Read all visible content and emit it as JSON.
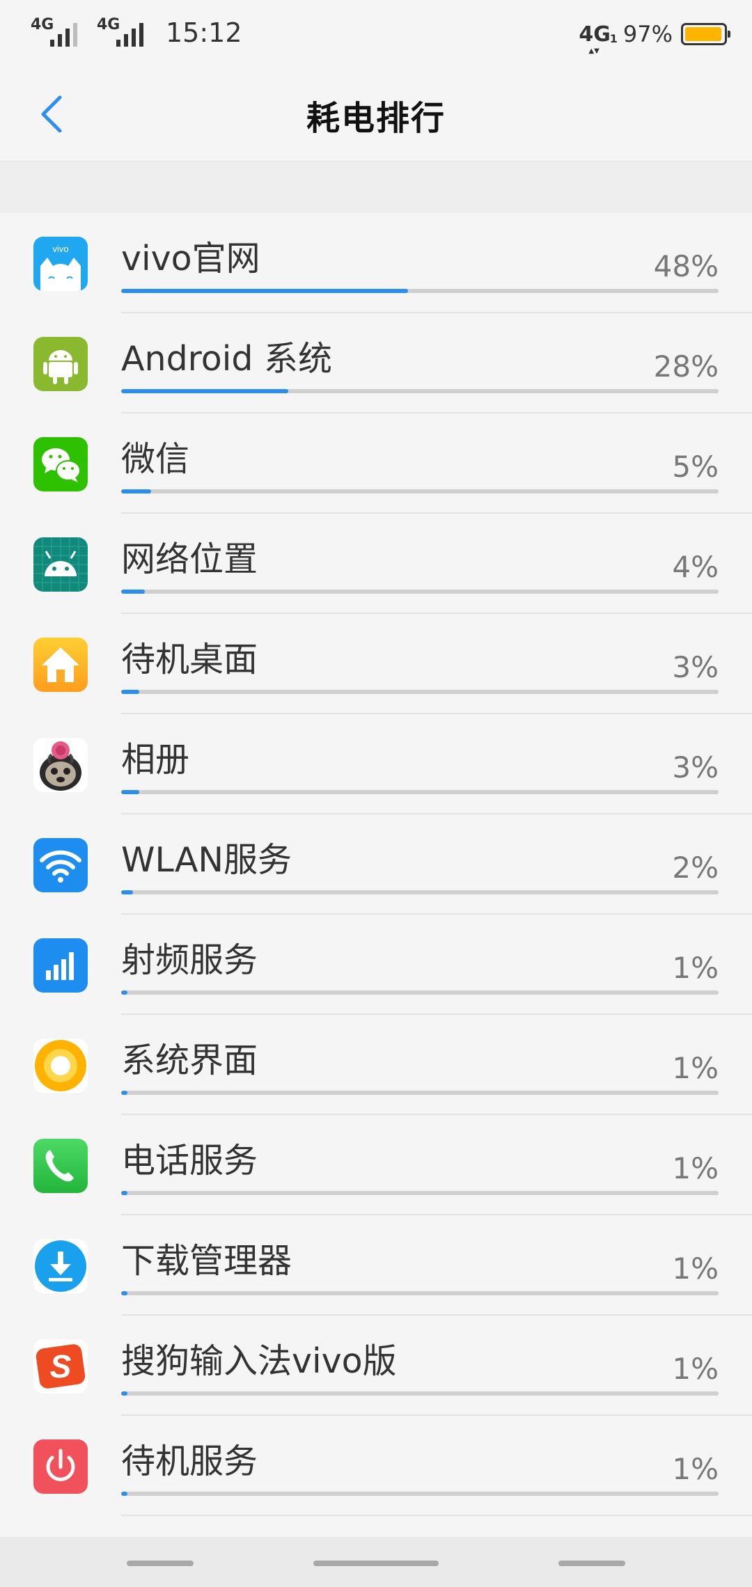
{
  "status_bar": {
    "sim1_type": "4G",
    "sim2_type": "4G",
    "time": "15:12",
    "data_network": "4G",
    "data_sim_index": "1",
    "battery_percent": "97%",
    "battery_level": 0.97,
    "battery_color": "#ffb400"
  },
  "header": {
    "title": "耗电排行",
    "back_icon": "chevron-left-icon",
    "accent": "#2b8ff0"
  },
  "apps": [
    {
      "name": "vivo官网",
      "percent": "48%",
      "value": 48,
      "icon": "vivo-mascot-icon"
    },
    {
      "name": "Android 系统",
      "percent": "28%",
      "value": 28,
      "icon": "android-robot-icon"
    },
    {
      "name": "微信",
      "percent": "5%",
      "value": 5,
      "icon": "wechat-icon"
    },
    {
      "name": "网络位置",
      "percent": "4%",
      "value": 4,
      "icon": "android-head-grid-icon"
    },
    {
      "name": "待机桌面",
      "percent": "3%",
      "value": 3,
      "icon": "home-icon"
    },
    {
      "name": "相册",
      "percent": "3%",
      "value": 3,
      "icon": "photo-avatar-icon"
    },
    {
      "name": "WLAN服务",
      "percent": "2%",
      "value": 2,
      "icon": "wifi-icon"
    },
    {
      "name": "射频服务",
      "percent": "1%",
      "value": 1,
      "icon": "signal-bars-icon"
    },
    {
      "name": "系统界面",
      "percent": "1%",
      "value": 1,
      "icon": "ring-icon"
    },
    {
      "name": "电话服务",
      "percent": "1%",
      "value": 1,
      "icon": "phone-icon"
    },
    {
      "name": "下载管理器",
      "percent": "1%",
      "value": 1,
      "icon": "download-icon"
    },
    {
      "name": "搜狗输入法vivo版",
      "percent": "1%",
      "value": 1,
      "icon": "sogou-icon"
    },
    {
      "name": "待机服务",
      "percent": "1%",
      "value": 1,
      "icon": "power-icon"
    }
  ],
  "nav_bar": {
    "buttons": [
      "recents-pill",
      "home-pill",
      "back-pill"
    ]
  }
}
